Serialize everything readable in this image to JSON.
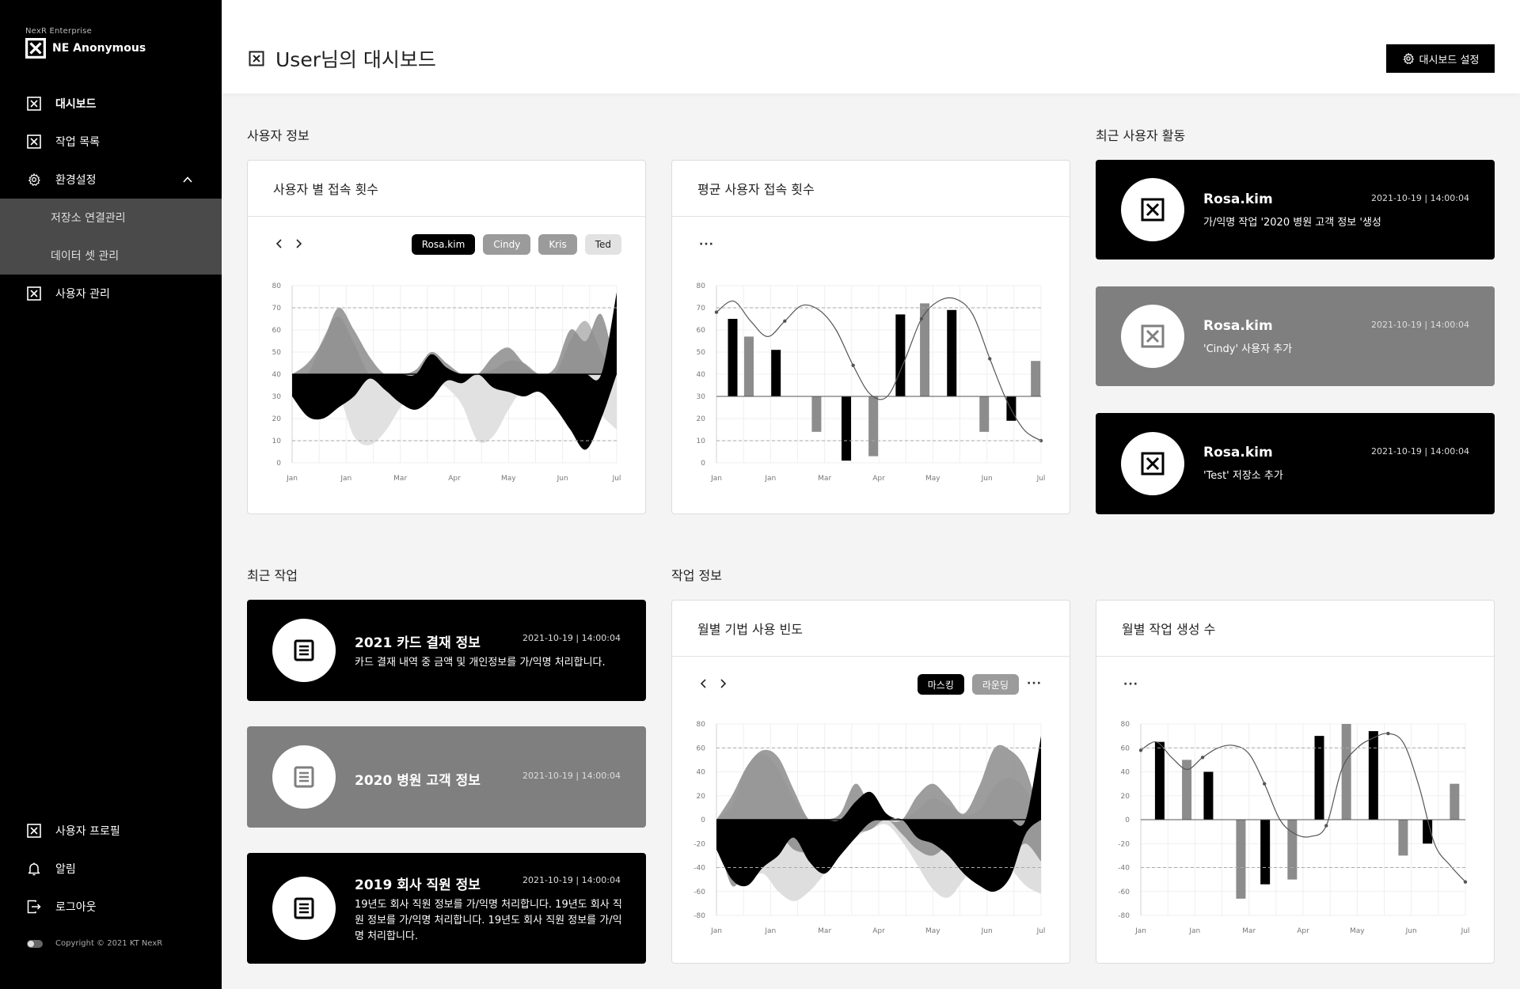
{
  "brand": {
    "company": "NexR Enterprise",
    "name": "NE Anonymous"
  },
  "sidebar": {
    "items": [
      {
        "label": "대시보드",
        "icon": "x-box-icon",
        "active": true
      },
      {
        "label": "작업 목록",
        "icon": "x-box-icon"
      },
      {
        "label": "환경설정",
        "icon": "gear-icon",
        "expanded": true
      }
    ],
    "sub_items": [
      {
        "label": "저장소 연결관리"
      },
      {
        "label": "데이터 셋 관리"
      }
    ],
    "after_items": [
      {
        "label": "사용자 관리",
        "icon": "x-box-icon"
      }
    ],
    "bottom_items": [
      {
        "label": "사용자 프로필",
        "icon": "x-box-icon"
      },
      {
        "label": "알림",
        "icon": "bell-icon"
      },
      {
        "label": "로그아웃",
        "icon": "logout-icon"
      }
    ],
    "copyright": "Copyright © 2021 KT NexR"
  },
  "header": {
    "title": "User님의 대시보드",
    "settings_label": "대시보드 설정"
  },
  "sections": {
    "user_info": "사용자 정보",
    "recent_activity": "최근 사용자 활동",
    "recent_tasks": "최근 작업",
    "task_info": "작업 정보"
  },
  "cards": {
    "user_access": {
      "title": "사용자 별 접속 횟수",
      "filters": [
        "Rosa.kim",
        "Cindy",
        "Kris",
        "Ted"
      ]
    },
    "avg_access": {
      "title": "평균 사용자 접속 횟수"
    },
    "monthly_technique": {
      "title": "월별 기법 사용 빈도",
      "filters": [
        "마스킹",
        "라운딩"
      ]
    },
    "monthly_tasks": {
      "title": "월별 작업 생성 수"
    }
  },
  "activities": [
    {
      "user": "Rosa.kim",
      "date": "2021-10-19",
      "time": "14:00:04",
      "desc": "가/익명 작업 '2020 병원 고객 정보 '생성"
    },
    {
      "user": "Rosa.kim",
      "date": "2021-10-19",
      "time": "14:00:04",
      "desc": "'Cindy' 사용자 추가"
    },
    {
      "user": "Rosa.kim",
      "date": "2021-10-19",
      "time": "14:00:04",
      "desc": "'Test' 저장소 추가"
    }
  ],
  "tasks": [
    {
      "title": "2021 카드 결재 정보",
      "date": "2021-10-19",
      "time": "14:00:04",
      "desc": "카드 결재 내역 중 금액 및 개인정보를 가/익명 처리합니다."
    },
    {
      "title": "2020 병원 고객 정보",
      "date": "2021-10-19",
      "time": "14:00:04",
      "desc": ""
    },
    {
      "title": "2019 회사 직원 정보",
      "date": "2021-10-19",
      "time": "14:00:04",
      "desc": "19년도 회사 직원 정보를 가/익명 처리합니다. 19년도 회사 직원 정보를 가/익명 처리합니다.  19년도 회사 직원 정보를 가/익명 처리합니다."
    }
  ],
  "colors": {
    "sidebar_bg": "#000000",
    "subnav_bg": "#4a4a4a",
    "card_black": "#000000",
    "card_gray": "#7f7f7f",
    "series_black": "#000000",
    "series_gray": "#8c8c8c",
    "series_light": "#d8d8d8"
  },
  "chart_data": [
    {
      "type": "area",
      "categories": [
        "Jan",
        "Jan",
        "Mar",
        "Apr",
        "May",
        "Jun",
        "Jul"
      ],
      "ylim": [
        0,
        80
      ],
      "baseline": 40,
      "yticks": [
        0,
        10,
        20,
        30,
        40,
        50,
        60,
        70,
        80
      ],
      "series": [
        {
          "name": "Rosa.kim",
          "color": "#000000",
          "upper": [
            40,
            40,
            40,
            40,
            40,
            40,
            40,
            40,
            40,
            49,
            43,
            40,
            40,
            40,
            40,
            40,
            40,
            40,
            40,
            40,
            40,
            77
          ],
          "lower": [
            30,
            21,
            20,
            25,
            30,
            38,
            33,
            27,
            24,
            29,
            37,
            36,
            40,
            34,
            32,
            30,
            32,
            25,
            15,
            6,
            20,
            40
          ]
        },
        {
          "name": "Cindy",
          "color": "#8c8c8c",
          "upper": [
            40,
            45,
            55,
            70,
            60,
            48,
            40,
            40,
            42,
            50,
            45,
            40,
            40,
            48,
            52,
            45,
            40,
            43,
            60,
            55,
            67,
            40
          ]
        },
        {
          "name": "Kris",
          "color": "#b0b0b0",
          "upper": [
            38,
            40,
            56,
            66,
            54,
            40,
            40,
            40,
            41,
            44,
            40,
            40,
            40,
            42,
            46,
            45,
            40,
            40,
            55,
            64,
            50,
            40
          ]
        },
        {
          "name": "Ted",
          "color": "#dcdcdc",
          "lower": [
            34,
            26,
            26,
            30,
            12,
            8,
            14,
            25,
            34,
            38,
            34,
            26,
            10,
            12,
            24,
            34,
            36,
            34,
            28,
            34,
            22,
            15
          ]
        }
      ]
    },
    {
      "type": "bar",
      "categories": [
        "Jan",
        "Jan",
        "Mar",
        "Apr",
        "May",
        "Jun",
        "Jul"
      ],
      "ylim": [
        0,
        80
      ],
      "baseline": 30,
      "yticks": [
        0,
        10,
        20,
        30,
        40,
        50,
        60,
        70,
        80
      ],
      "bars": [
        {
          "x": 0.3,
          "value": 65,
          "color": "black"
        },
        {
          "x": 0.6,
          "value": 57,
          "color": "gray"
        },
        {
          "x": 1.1,
          "value": 51,
          "color": "black"
        },
        {
          "x": 1.85,
          "value": 14,
          "color": "gray"
        },
        {
          "x": 2.4,
          "value": 1,
          "color": "black"
        },
        {
          "x": 2.9,
          "value": 3,
          "color": "gray"
        },
        {
          "x": 3.4,
          "value": 67,
          "color": "black"
        },
        {
          "x": 3.85,
          "value": 72,
          "color": "gray"
        },
        {
          "x": 4.35,
          "value": 69,
          "color": "black"
        },
        {
          "x": 4.95,
          "value": 14,
          "color": "gray"
        },
        {
          "x": 5.45,
          "value": 19,
          "color": "black"
        },
        {
          "x": 5.9,
          "value": 46,
          "color": "gray"
        }
      ],
      "line": [
        68,
        73,
        64,
        57,
        64,
        71,
        69,
        60,
        44,
        31,
        30,
        46,
        65,
        73,
        74,
        67,
        47,
        28,
        15,
        10
      ],
      "dashed": [
        10,
        70
      ]
    },
    {
      "type": "area",
      "categories": [
        "Jan",
        "Jan",
        "Mar",
        "Apr",
        "May",
        "Jun",
        "Jul"
      ],
      "ylim": [
        -80,
        80
      ],
      "baseline": 0,
      "yticks": [
        -80,
        -60,
        -40,
        -20,
        0,
        20,
        40,
        60,
        80
      ],
      "series": [
        {
          "name": "마스킹",
          "color": "#000000",
          "upper": [
            0,
            0,
            0,
            0,
            0,
            0,
            0,
            0,
            0,
            15,
            23,
            5,
            0,
            0,
            0,
            0,
            0,
            0,
            0,
            0,
            0,
            70
          ],
          "lower": [
            -25,
            -50,
            -55,
            -40,
            -30,
            -15,
            -35,
            -45,
            -30,
            -15,
            -2,
            0,
            0,
            -15,
            -20,
            -30,
            -45,
            -55,
            -60,
            -48,
            -12,
            0
          ]
        },
        {
          "name": "라운딩",
          "color": "#8c8c8c",
          "upper": [
            0,
            20,
            45,
            58,
            52,
            25,
            0,
            0,
            5,
            30,
            10,
            0,
            0,
            20,
            30,
            18,
            5,
            28,
            60,
            58,
            42,
            0
          ],
          "lower": [
            -10,
            -55,
            -38,
            -20,
            -12,
            -25,
            -28,
            -30,
            -22,
            -12,
            -8,
            0,
            -12,
            -25,
            -30,
            -20,
            -8,
            -18,
            -10,
            -30,
            -20,
            -35
          ]
        },
        {
          "name": "",
          "color": "#d8d8d8",
          "upper": [
            0,
            12,
            45,
            55,
            42,
            18,
            0,
            0,
            0,
            0,
            0,
            0,
            0,
            8,
            18,
            12,
            4,
            8,
            28,
            35,
            25,
            0
          ],
          "lower": [
            -10,
            -50,
            -52,
            -45,
            -60,
            -68,
            -60,
            -45,
            -28,
            -15,
            -8,
            -4,
            -18,
            -38,
            -58,
            -65,
            -50,
            -35,
            -25,
            -40,
            -55,
            -62
          ]
        }
      ],
      "dashed": [
        -40,
        60
      ]
    },
    {
      "type": "bar",
      "categories": [
        "Jan",
        "Jan",
        "Mar",
        "Apr",
        "May",
        "Jun",
        "Jul"
      ],
      "ylim": [
        -80,
        80
      ],
      "baseline": 0,
      "yticks": [
        -80,
        -60,
        -40,
        -20,
        0,
        20,
        40,
        60,
        80
      ],
      "bars": [
        {
          "x": 0.35,
          "value": 65,
          "color": "black"
        },
        {
          "x": 0.85,
          "value": 50,
          "color": "gray"
        },
        {
          "x": 1.25,
          "value": 40,
          "color": "black"
        },
        {
          "x": 1.85,
          "value": -66,
          "color": "gray"
        },
        {
          "x": 2.3,
          "value": -54,
          "color": "black"
        },
        {
          "x": 2.8,
          "value": -50,
          "color": "gray"
        },
        {
          "x": 3.3,
          "value": 70,
          "color": "black"
        },
        {
          "x": 3.8,
          "value": 80,
          "color": "gray"
        },
        {
          "x": 4.3,
          "value": 74,
          "color": "black"
        },
        {
          "x": 4.85,
          "value": -30,
          "color": "gray"
        },
        {
          "x": 5.3,
          "value": -20,
          "color": "black"
        },
        {
          "x": 5.8,
          "value": 30,
          "color": "gray"
        }
      ],
      "line": [
        58,
        65,
        52,
        42,
        52,
        60,
        62,
        55,
        30,
        0,
        -12,
        -14,
        -5,
        42,
        60,
        68,
        72,
        64,
        28,
        -20,
        -38,
        -52
      ],
      "dashed": [
        -40,
        60
      ]
    }
  ]
}
